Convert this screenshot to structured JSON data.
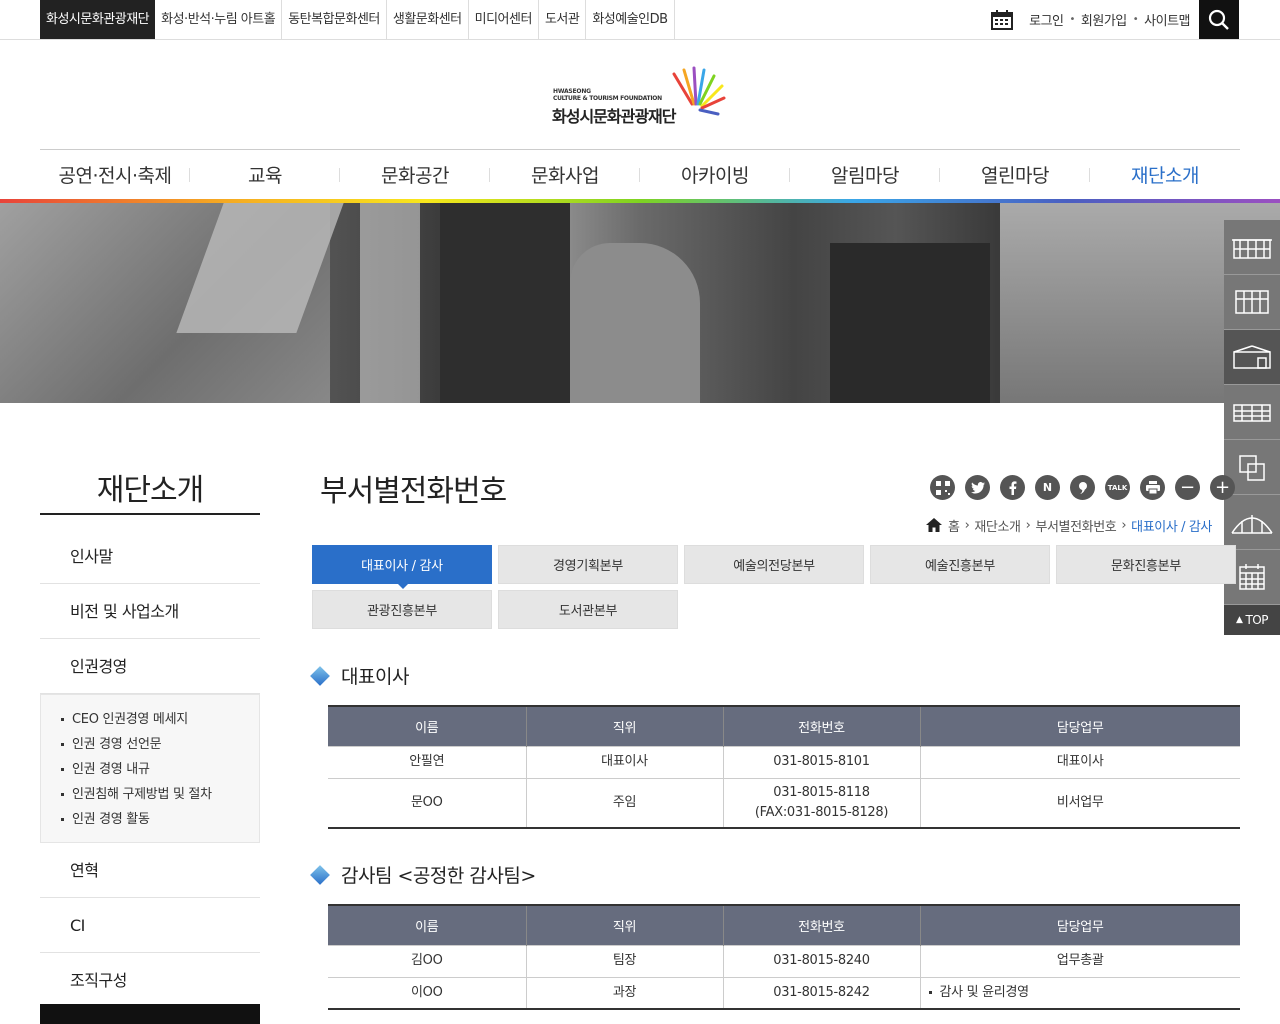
{
  "family_sites": [
    "화성시문화관광재단",
    "화성·반석·누림 아트홀",
    "동탄복합문화센터",
    "생활문화센터",
    "미디어센터",
    "도서관",
    "화성예술인DB"
  ],
  "util": {
    "login": "로그인",
    "join": "회원가입",
    "sitemap": "사이트맵"
  },
  "logo": {
    "en_line1": "HWASEONG",
    "en_line2": "CULTURE & TOURISM FOUNDATION",
    "kr": "화성시문화관광재단"
  },
  "gnb": [
    "공연·전시·축제",
    "교육",
    "문화공간",
    "문화사업",
    "아카이빙",
    "알림마당",
    "열린마당",
    "재단소개"
  ],
  "quick_top": "TOP",
  "lnb": {
    "title": "재단소개",
    "items": [
      "인사말",
      "비전 및 사업소개",
      "인권경영"
    ],
    "sub_items": [
      "CEO 인권경영 메세지",
      "인권 경영 선언문",
      "인권 경영 내규",
      "인권침해 구제방법 및 절차",
      "인권 경영 활동"
    ],
    "items_after": [
      "연혁",
      "CI",
      "조직구성"
    ]
  },
  "page_title": "부서별전화번호",
  "sns": [
    "QR",
    "t",
    "f",
    "N",
    "b",
    "TALK",
    "print",
    "−",
    "+"
  ],
  "breadcrumb": {
    "home": "홈",
    "level1": "재단소개",
    "level2": "부서별전화번호",
    "current": "대표이사 / 감사"
  },
  "tabs": [
    "대표이사 / 감사",
    "경영기획본부",
    "예술의전당본부",
    "예술진흥본부",
    "문화진흥본부",
    "관광진흥본부",
    "도서관본부"
  ],
  "section1": {
    "title": "대표이사",
    "headers": [
      "이름",
      "직위",
      "전화번호",
      "담당업무"
    ],
    "rows": [
      {
        "name": "안필연",
        "position": "대표이사",
        "phone": "031-8015-8101",
        "phone2": "",
        "duty": "대표이사"
      },
      {
        "name": "문OO",
        "position": "주임",
        "phone": "031-8015-8118",
        "phone2": "(FAX:031-8015-8128)",
        "duty": "비서업무"
      }
    ]
  },
  "section2": {
    "title": "감사팀 <공정한 감사팀>",
    "headers": [
      "이름",
      "직위",
      "전화번호",
      "담당업무"
    ],
    "rows": [
      {
        "name": "김OO",
        "position": "팀장",
        "phone": "031-8015-8240",
        "duty": "업무총괄"
      },
      {
        "name": "이OO",
        "position": "과장",
        "phone": "031-8015-8242",
        "duty": "감사 및 윤리경영"
      }
    ]
  },
  "colors": {
    "accent": "#2a6fc9",
    "table_header": "#666c7e"
  }
}
